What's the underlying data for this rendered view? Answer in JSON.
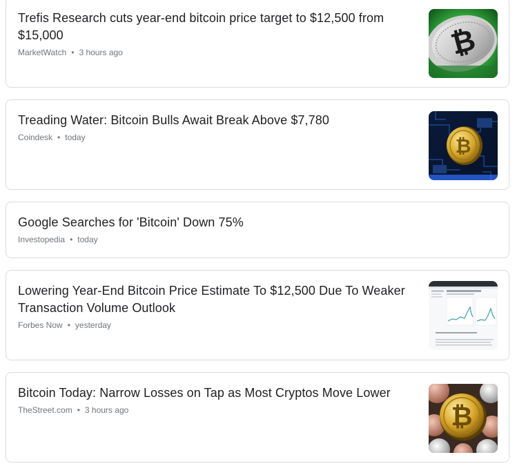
{
  "articles": [
    {
      "headline": "Trefis Research cuts year-end bitcoin price target to $12,500 from $15,000",
      "source": "MarketWatch",
      "time": "3 hours ago",
      "thumbnail": "bitcoin-coin-green-icon"
    },
    {
      "headline": "Treading Water: Bitcoin Bulls Await Break Above $7,780",
      "source": "Coindesk",
      "time": "today",
      "thumbnail": "bitcoin-circuit-board-icon"
    },
    {
      "headline": "Google Searches for 'Bitcoin' Down 75%",
      "source": "Investopedia",
      "time": "today"
    },
    {
      "headline": "Lowering Year-End Bitcoin Price Estimate To $12,500 Due To Weaker Transaction Volume Outlook",
      "source": "Forbes Now",
      "time": "yesterday",
      "thumbnail": "price-chart-screenshot-icon"
    },
    {
      "headline": "Bitcoin Today: Narrow Losses on Tap as Most Cryptos Move Lower",
      "source": "TheStreet.com",
      "time": "3 hours ago",
      "thumbnail": "crypto-coins-pile-icon"
    }
  ],
  "separator": "•"
}
